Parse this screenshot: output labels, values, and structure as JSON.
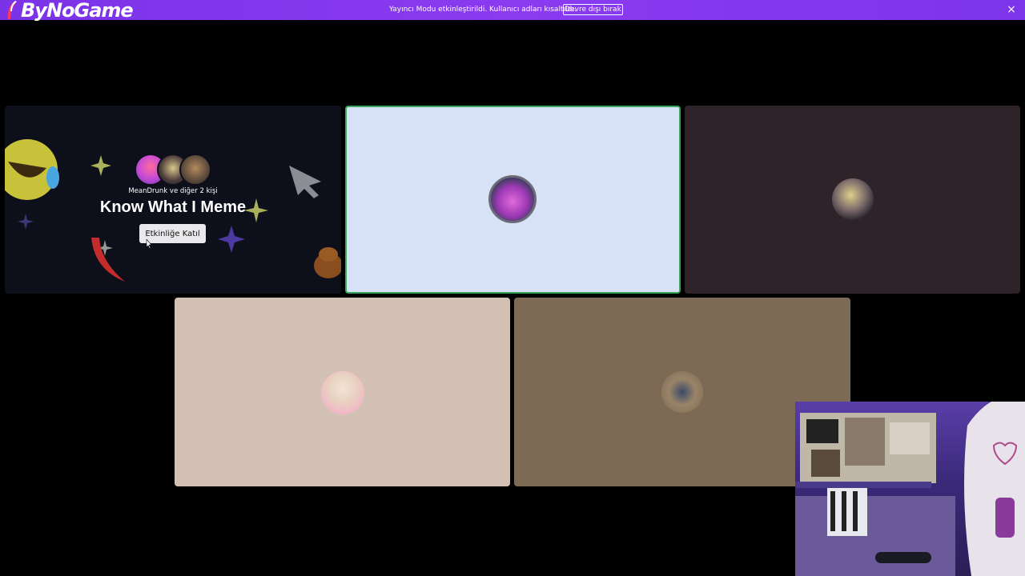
{
  "banner": {
    "logo_text": "ByNoGame",
    "message": "Yayıncı Modu etkinleştirildi. Kullanıcı adları kısaltıldı.",
    "disable_label": "Devre dışı bırak",
    "close_icon": "×"
  },
  "activity": {
    "participants_text": "MeanDrunk ve diğer 2 kişi",
    "title": "Know What I Meme",
    "join_label": "Etkinliğe Katıl"
  },
  "tiles": [
    {
      "id": "user-1",
      "background": "#d7e2f7",
      "speaking": true
    },
    {
      "id": "user-2",
      "background": "#2e2329",
      "speaking": false
    },
    {
      "id": "user-3",
      "background": "#d4c1b5",
      "speaking": false
    },
    {
      "id": "user-4",
      "background": "#7c6a55",
      "speaking": false
    }
  ],
  "colors": {
    "banner": "#8a3bf0",
    "speaking_border": "#3ba55d",
    "activity_bg": "#0d0f1a"
  }
}
